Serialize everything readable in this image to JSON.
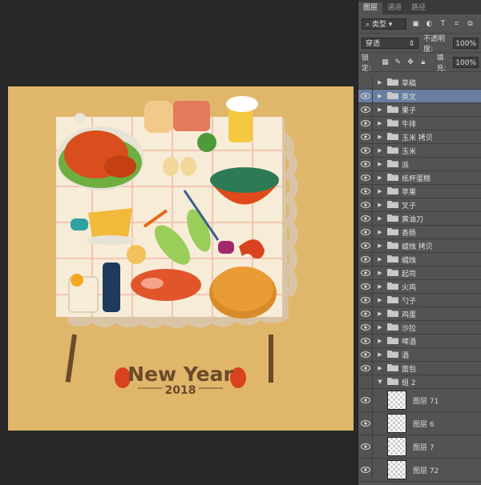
{
  "panel": {
    "tabs": [
      "图层",
      "通道",
      "路径"
    ],
    "filter": "类型",
    "blend_mode": "穿透",
    "opacity_label": "不透明度:",
    "opacity_value": "100%",
    "lock_label": "锁定:",
    "fill_label": "填充:",
    "fill_value": "100%"
  },
  "layer_groups": [
    {
      "name": "草稿",
      "visible": false,
      "selected": false
    },
    {
      "name": "英文",
      "visible": true,
      "selected": true
    },
    {
      "name": "果子",
      "visible": true,
      "selected": false
    },
    {
      "name": "牛排",
      "visible": true,
      "selected": false
    },
    {
      "name": "玉米 拷贝",
      "visible": true,
      "selected": false
    },
    {
      "name": "玉米",
      "visible": true,
      "selected": false
    },
    {
      "name": "派",
      "visible": true,
      "selected": false
    },
    {
      "name": "纸杯蛋糕",
      "visible": true,
      "selected": false
    },
    {
      "name": "苹果",
      "visible": true,
      "selected": false
    },
    {
      "name": "叉子",
      "visible": true,
      "selected": false
    },
    {
      "name": "黄油刀",
      "visible": true,
      "selected": false
    },
    {
      "name": "香肠",
      "visible": true,
      "selected": false
    },
    {
      "name": "蜡烛 拷贝",
      "visible": true,
      "selected": false
    },
    {
      "name": "蜡烛",
      "visible": true,
      "selected": false
    },
    {
      "name": "起司",
      "visible": true,
      "selected": false
    },
    {
      "name": "火鸡",
      "visible": true,
      "selected": false
    },
    {
      "name": "勺子",
      "visible": true,
      "selected": false
    },
    {
      "name": "鸡蛋",
      "visible": true,
      "selected": false
    },
    {
      "name": "沙拉",
      "visible": true,
      "selected": false
    },
    {
      "name": "啤酒",
      "visible": true,
      "selected": false
    },
    {
      "name": "酒",
      "visible": true,
      "selected": false
    },
    {
      "name": "面包",
      "visible": true,
      "selected": false
    }
  ],
  "open_group": {
    "name": "组 2",
    "visible": false
  },
  "pixel_layers": [
    {
      "name": "图层 71",
      "visible": true
    },
    {
      "name": "图层 6",
      "visible": true
    },
    {
      "name": "图层 7",
      "visible": true
    },
    {
      "name": "图层 72",
      "visible": true
    }
  ],
  "artwork": {
    "title": "New Year",
    "year": "2018",
    "colors": {
      "background": "#e0b66b",
      "tablecloth": "#f7ecd7",
      "turkey": "#d94e1c",
      "text": "#6b4a2a",
      "accent_red": "#d9421e",
      "green": "#7ab648"
    }
  }
}
